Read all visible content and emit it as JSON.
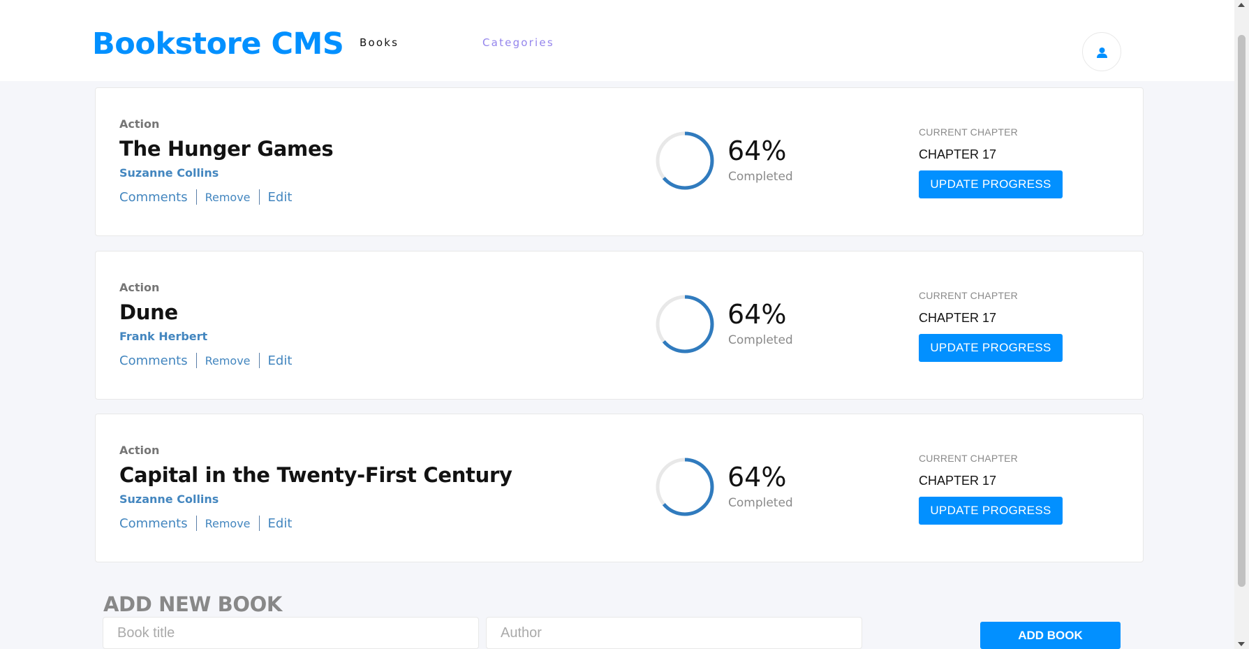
{
  "header": {
    "logo": "Bookstore CMS",
    "nav": [
      {
        "label": "Books"
      },
      {
        "label": "Categories"
      }
    ],
    "user_icon": "user-icon"
  },
  "books": [
    {
      "category": "Action",
      "title": "The Hunger Games",
      "author": "Suzanne Collins",
      "actions": {
        "comments": "Comments",
        "remove": "Remove",
        "edit": "Edit"
      },
      "progress": {
        "percent_text": "64%",
        "value": 0.64,
        "label": "Completed"
      },
      "chapter": {
        "label": "CURRENT CHAPTER",
        "value": "CHAPTER 17",
        "button": "UPDATE PROGRESS"
      }
    },
    {
      "category": "Action",
      "title": "Dune",
      "author": "Frank Herbert",
      "actions": {
        "comments": "Comments",
        "remove": "Remove",
        "edit": "Edit"
      },
      "progress": {
        "percent_text": "64%",
        "value": 0.64,
        "label": "Completed"
      },
      "chapter": {
        "label": "CURRENT CHAPTER",
        "value": "CHAPTER 17",
        "button": "UPDATE PROGRESS"
      }
    },
    {
      "category": "Action",
      "title": "Capital in the Twenty-First Century",
      "author": "Suzanne Collins",
      "actions": {
        "comments": "Comments",
        "remove": "Remove",
        "edit": "Edit"
      },
      "progress": {
        "percent_text": "64%",
        "value": 0.64,
        "label": "Completed"
      },
      "chapter": {
        "label": "CURRENT CHAPTER",
        "value": "CHAPTER 17",
        "button": "UPDATE PROGRESS"
      }
    }
  ],
  "add_book": {
    "heading": "ADD NEW BOOK",
    "title_placeholder": "Book title",
    "author_placeholder": "Author",
    "button": "ADD BOOK"
  },
  "colors": {
    "primary": "#0290ff",
    "author_link": "#4386bf",
    "progress_track": "#e8e8e8",
    "progress_fill": "#307bbe",
    "page_bg": "#f5f6fa"
  }
}
